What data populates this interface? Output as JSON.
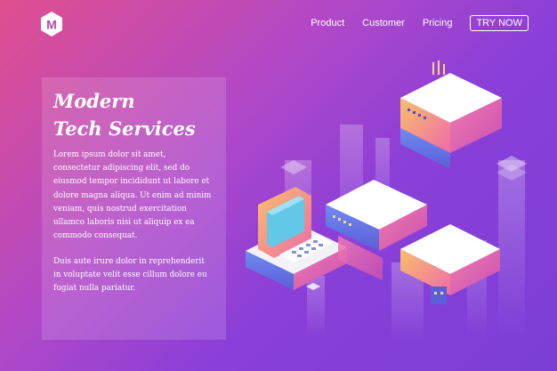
{
  "brand": {
    "logo_letter": "M",
    "logo_color": "#ffffff"
  },
  "nav": {
    "items": [
      "Product",
      "Customer",
      "Pricing"
    ],
    "cta_label": "TRY NOW"
  },
  "hero": {
    "title_line1": "Modern",
    "title_line2": "Tech Services",
    "paragraph1": "Lorem ipsum dolor sit amet, consectetur adipiscing elit, sed do eiusmod tempor incididunt ut labore et dolore magna aliqua. Ut enim ad minim veniam, quis nostrud exercitation ullamco laboris nisi ut aliquip ex ea commodo consequat.",
    "paragraph2": "Duis aute irure dolor in reprehenderit in voluptate velit esse cillum dolore eu fugiat nulla pariatur."
  },
  "colors": {
    "bg_start": "#e04f8f",
    "bg_end": "#7b3fd6",
    "block_top": "#ffffff",
    "block_side_warm": "#f6a85a",
    "block_side_pink": "#e95aa8",
    "screen": "#63c7e8"
  }
}
